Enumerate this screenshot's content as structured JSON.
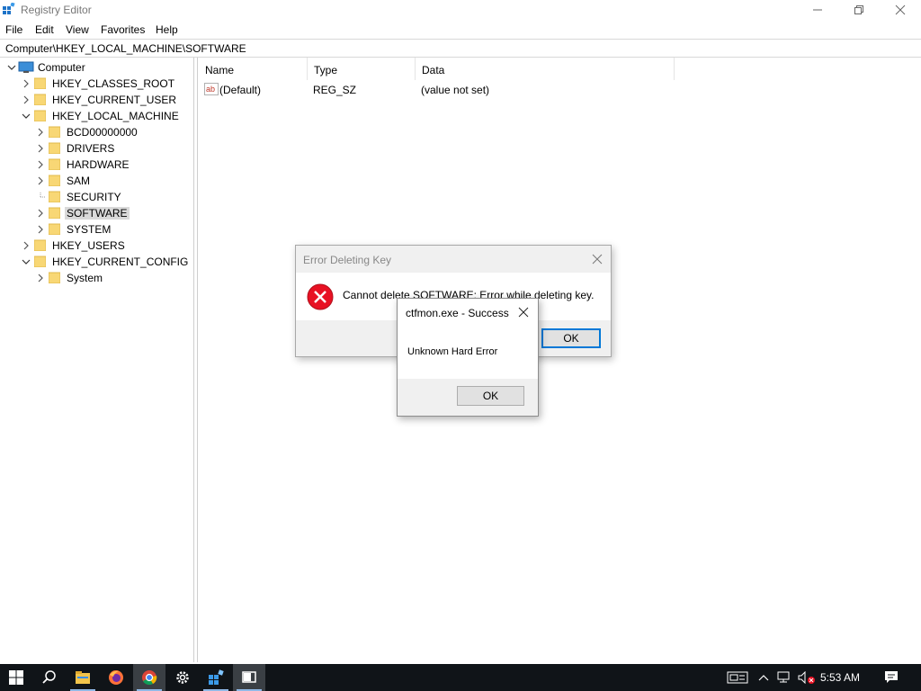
{
  "window": {
    "title": "Registry Editor"
  },
  "menu": [
    "File",
    "Edit",
    "View",
    "Favorites",
    "Help"
  ],
  "address": "Computer\\HKEY_LOCAL_MACHINE\\SOFTWARE",
  "tree": {
    "root": "Computer",
    "nodes": [
      {
        "label": "HKEY_CLASSES_ROOT"
      },
      {
        "label": "HKEY_CURRENT_USER"
      },
      {
        "label": "HKEY_LOCAL_MACHINE"
      },
      {
        "label": "BCD00000000"
      },
      {
        "label": "DRIVERS"
      },
      {
        "label": "HARDWARE"
      },
      {
        "label": "SAM"
      },
      {
        "label": "SECURITY"
      },
      {
        "label": "SOFTWARE"
      },
      {
        "label": "SYSTEM"
      },
      {
        "label": "HKEY_USERS"
      },
      {
        "label": "HKEY_CURRENT_CONFIG"
      },
      {
        "label": "System"
      }
    ]
  },
  "list": {
    "columns": [
      "Name",
      "Type",
      "Data"
    ],
    "rows": [
      {
        "name": "(Default)",
        "type": "REG_SZ",
        "data": "(value not set)"
      }
    ]
  },
  "dialog_error": {
    "title": "Error Deleting Key",
    "message": "Cannot delete SOFTWARE:  Error while deleting key.",
    "ok": "OK"
  },
  "dialog_ctfmon": {
    "title": "ctfmon.exe - Success",
    "message": "Unknown Hard Error",
    "ok": "OK"
  },
  "taskbar": {
    "clock": "5:53 AM",
    "apps": [
      "start-icon",
      "search-icon",
      "file-explorer-icon",
      "firefox-icon",
      "chrome-icon",
      "settings-icon",
      "registry-editor-icon",
      "window-app-icon"
    ]
  },
  "colors": {
    "accent": "#0078d7",
    "error": "#e81123",
    "taskbar": "#101418",
    "selection": "#d9d9d9"
  }
}
